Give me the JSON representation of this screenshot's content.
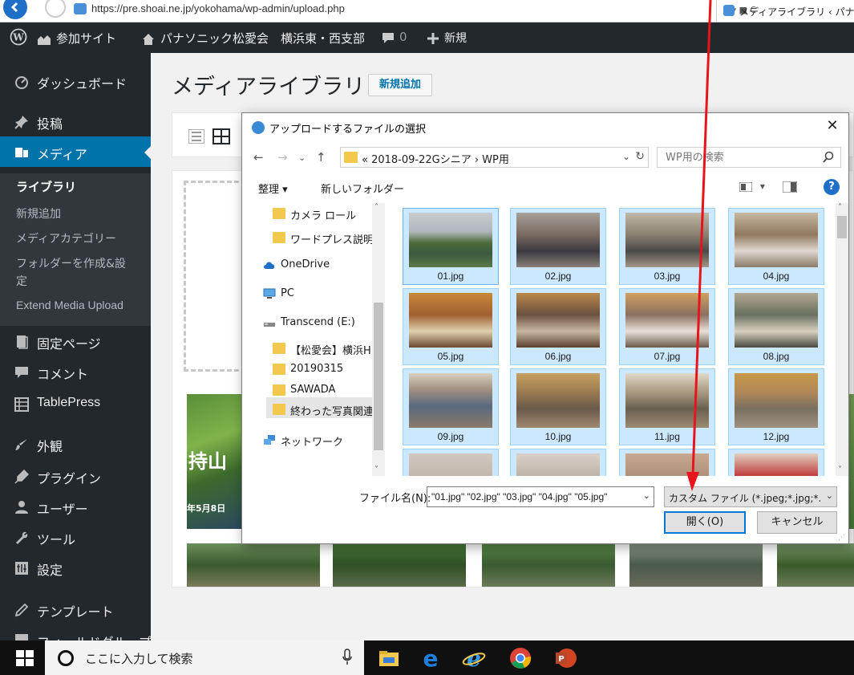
{
  "browser": {
    "url": "https://pre.shoai.ne.jp/yokohama/wp-admin/upload.php",
    "url_controls": "ρ ▾ ■ C",
    "tab_title": "メディアライブラリ ‹ パナソニッ"
  },
  "adminbar": {
    "site_sections": "参加サイト",
    "site_name": "パナソニック松愛会　横浜東・西支部",
    "comments_count": "0",
    "new_label": "新規"
  },
  "sidebar": {
    "items": [
      {
        "label": "ダッシュボード",
        "icon": "dashboard-icon"
      },
      {
        "label": "投稿",
        "icon": "pin-icon"
      },
      {
        "label": "メディア",
        "icon": "media-icon"
      },
      {
        "label": "固定ページ",
        "icon": "page-icon"
      },
      {
        "label": "コメント",
        "icon": "comment-icon"
      },
      {
        "label": "TablePress",
        "icon": "table-icon"
      },
      {
        "label": "外観",
        "icon": "brush-icon"
      },
      {
        "label": "プラグイン",
        "icon": "plugin-icon"
      },
      {
        "label": "ユーザー",
        "icon": "user-icon"
      },
      {
        "label": "ツール",
        "icon": "wrench-icon"
      },
      {
        "label": "設定",
        "icon": "settings-icon"
      },
      {
        "label": "テンプレート",
        "icon": "pencil-icon"
      },
      {
        "label": "フィールドグループ",
        "icon": "fields-icon"
      }
    ],
    "media_submenu": [
      {
        "label": "ライブラリ",
        "current": true
      },
      {
        "label": "新規追加"
      },
      {
        "label": "メディアカテゴリー"
      },
      {
        "label": "フォルダーを作成&設",
        "label2": "定"
      },
      {
        "label": "Extend Media Upload"
      }
    ]
  },
  "main": {
    "title": "メディアライブラリ",
    "add_new": "新規追加"
  },
  "dialog": {
    "title": "アップロードするファイルの選択",
    "close": "✕",
    "path": "« 2018-09-22Gシニア › WP用",
    "search_placeholder": "WP用の検索",
    "organize": "整理 ▾",
    "new_folder": "新しいフォルダー",
    "help": "?",
    "tree": [
      {
        "label": "カメラ ロール",
        "icon": "folder-icon"
      },
      {
        "label": "ワードプレス説明等",
        "icon": "folder-icon"
      },
      {
        "label": "OneDrive",
        "icon": "cloud-icon"
      },
      {
        "label": "PC",
        "icon": "pc-icon"
      },
      {
        "label": "Transcend (E:)",
        "icon": "drive-icon"
      },
      {
        "label": "【松愛会】横浜HP",
        "icon": "folder-icon"
      },
      {
        "label": "20190315",
        "icon": "folder-icon"
      },
      {
        "label": "SAWADA",
        "icon": "folder-icon"
      },
      {
        "label": "終わった写真関連",
        "icon": "folder-icon"
      },
      {
        "label": "ネットワーク",
        "icon": "network-icon"
      }
    ],
    "files": [
      {
        "name": "01.jpg"
      },
      {
        "name": "02.jpg"
      },
      {
        "name": "03.jpg"
      },
      {
        "name": "04.jpg"
      },
      {
        "name": "05.jpg"
      },
      {
        "name": "06.jpg"
      },
      {
        "name": "07.jpg"
      },
      {
        "name": "08.jpg"
      },
      {
        "name": "09.jpg"
      },
      {
        "name": "10.jpg"
      },
      {
        "name": "11.jpg"
      },
      {
        "name": "12.jpg"
      }
    ],
    "filename_label": "ファイル名(N):",
    "filename_value": "\"01.jpg\" \"02.jpg\" \"03.jpg\" \"04.jpg\" \"05.jpg\"",
    "filter_value": "カスタム ファイル (*.jpeg;*.jpg;*.jpe",
    "open_button": "開く(O)",
    "cancel_button": "キャンセル"
  },
  "taskbar": {
    "search_placeholder": "ここに入力して検索"
  },
  "colors": {
    "wp_dark": "#23282d",
    "wp_blue": "#0073aa",
    "selection": "#cce8ff",
    "arrow": "#e8141c"
  }
}
